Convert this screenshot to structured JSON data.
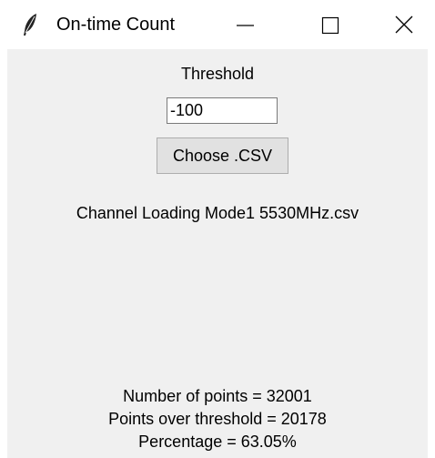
{
  "window": {
    "title": "On-time Count",
    "icon": "feather-icon"
  },
  "form": {
    "threshold_label": "Threshold",
    "threshold_value": "-100",
    "choose_button_label": "Choose .CSV",
    "selected_file": "Channel Loading Mode1 5530MHz.csv"
  },
  "results": {
    "num_points": "Number of points = 32001",
    "points_over": "Points over threshold = 20178",
    "percentage": "Percentage = 63.05%"
  }
}
